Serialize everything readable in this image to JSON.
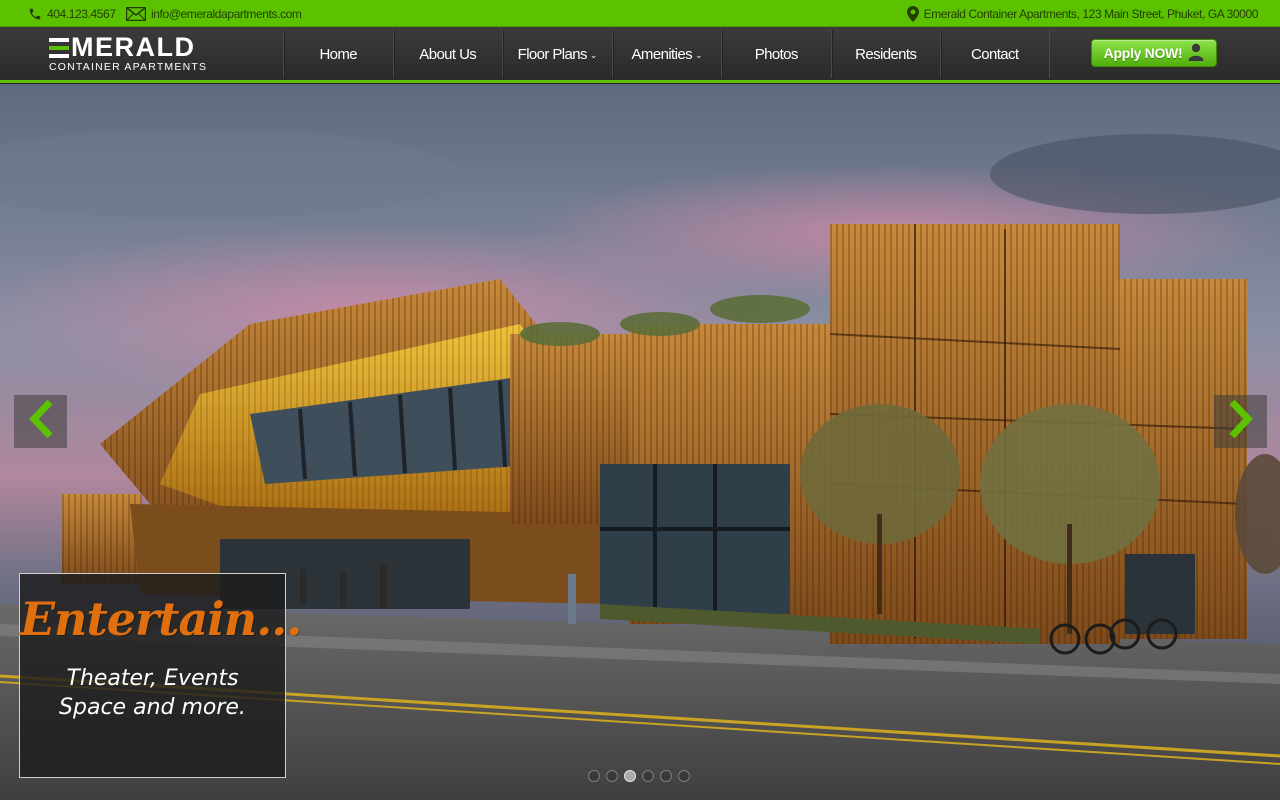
{
  "topbar": {
    "phone": "404.123.4567",
    "email": "info@emeraldapartments.com",
    "address": "Emerald Container Apartments, 123 Main Street, Phuket, GA 30000"
  },
  "logo": {
    "wordmark_rest": "ERALD",
    "wordmark_m": "M",
    "tagline": "CONTAINER APARTMENTS"
  },
  "nav": {
    "items": [
      {
        "label": "Home"
      },
      {
        "label": "About Us"
      },
      {
        "label": "Floor Plans",
        "dropdown": true
      },
      {
        "label": "Amenities",
        "dropdown": true
      },
      {
        "label": "Photos"
      },
      {
        "label": "Residents"
      },
      {
        "label": "Contact"
      }
    ],
    "chevron": "⌄"
  },
  "apply_button": {
    "label": "Apply NOW!",
    "icon": "user-icon"
  },
  "slider": {
    "caption_title": "Entertain...",
    "caption_text": "Theater, Events Space and more.",
    "active_slide": 3,
    "slide_count": 6,
    "prev_icon": "chevron-left-icon",
    "next_icon": "chevron-right-icon"
  },
  "colors": {
    "accent": "#5cc200",
    "caption_script": "#e0700f",
    "nav_bg": "#333333"
  }
}
